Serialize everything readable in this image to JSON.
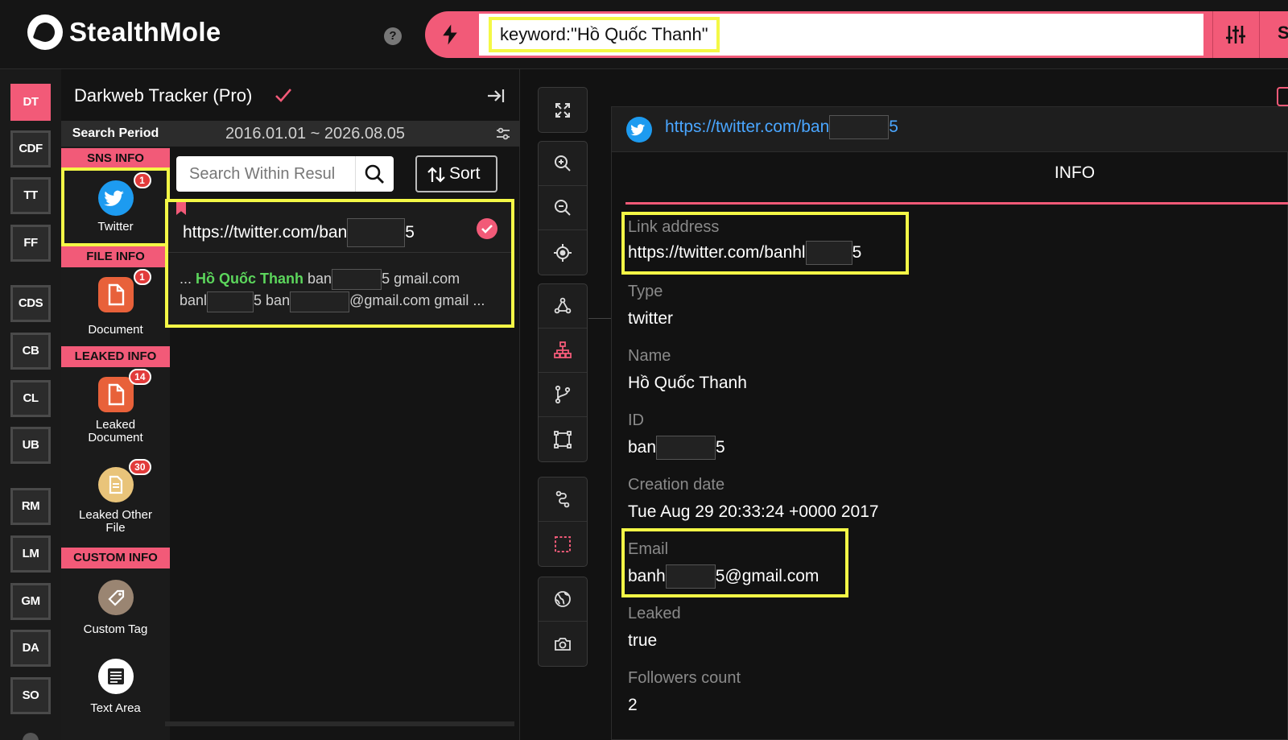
{
  "app": {
    "brand": "StealthMole",
    "search_query": "keyword:\"Hồ Quốc Thanh\"",
    "search_submit_label": "S"
  },
  "rail": {
    "items": [
      "DT",
      "CDF",
      "TT",
      "FF",
      "CDS",
      "CB",
      "CL",
      "UB",
      "RM",
      "LM",
      "GM",
      "DA",
      "SO"
    ],
    "active": "DT"
  },
  "panel": {
    "title": "Darkweb Tracker (Pro)",
    "search_period_label": "Search Period",
    "search_period_range": "2016.01.01 ~ 2026.08.05",
    "search_placeholder": "Search Within Resul",
    "sort_label": "Sort",
    "categories": {
      "sns": {
        "header": "SNS INFO",
        "items": [
          {
            "label": "Twitter",
            "badge": "1",
            "icon": "twitter-icon"
          }
        ]
      },
      "file": {
        "header": "FILE INFO",
        "items": [
          {
            "label": "Document",
            "badge": "1",
            "icon": "document-icon"
          }
        ]
      },
      "leaked": {
        "header": "LEAKED INFO",
        "items": [
          {
            "label": "Leaked Document",
            "badge": "14",
            "icon": "document-icon"
          },
          {
            "label": "Leaked Other File",
            "badge": "30",
            "icon": "file-icon"
          }
        ]
      },
      "custom": {
        "header": "CUSTOM INFO",
        "items": [
          {
            "label": "Custom Tag",
            "icon": "tag-icon"
          },
          {
            "label": "Text Area",
            "icon": "text-area-icon"
          }
        ]
      }
    },
    "result": {
      "url_prefix": "https://twitter.com/ban",
      "url_suffix": "5",
      "snippet_line1_prefix": "... ",
      "snippet_highlight": "Hồ Quốc Thanh",
      "snippet_line1_mid": " ban",
      "snippet_line1_suffix": "5 gmail.com",
      "snippet_line2_a": "banl",
      "snippet_line2_b": "5 ban",
      "snippet_line2_c": "@gmail.com gmail ..."
    }
  },
  "detail": {
    "url_prefix": "https://twitter.com/ban",
    "url_suffix": "5",
    "tab": "INFO",
    "fields": {
      "link": {
        "label": "Link address",
        "value_prefix": "https://twitter.com/banhl",
        "value_suffix": "5"
      },
      "type": {
        "label": "Type",
        "value": "twitter"
      },
      "name": {
        "label": "Name",
        "value": "Hồ Quốc Thanh"
      },
      "id": {
        "label": "ID",
        "value_prefix": "ban",
        "value_suffix": "5"
      },
      "creation": {
        "label": "Creation date",
        "value": "Tue Aug 29 20:33:24 +0000 2017"
      },
      "email": {
        "label": "Email",
        "value_prefix": "banh",
        "value_suffix": "5@gmail.com"
      },
      "leaked": {
        "label": "Leaked",
        "value": "true"
      },
      "followers": {
        "label": "Followers count",
        "value": "2"
      }
    }
  },
  "colors": {
    "accent": "#f25a78",
    "highlight_box": "#f4f846",
    "link": "#4aa6ff",
    "twitter": "#1d9bf0",
    "match_text": "#5cd65c",
    "badge": "#e23b3b"
  }
}
